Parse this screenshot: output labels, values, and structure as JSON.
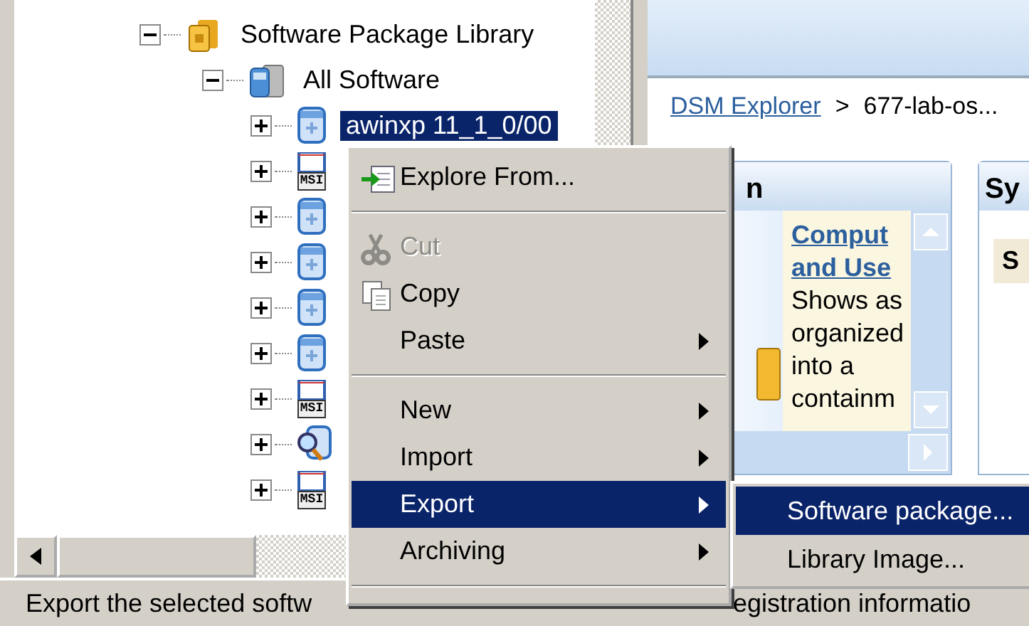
{
  "tree": {
    "items": [
      {
        "label": "Software Package Library",
        "kind": "library",
        "expanded": true,
        "selected": false,
        "children": [
          {
            "label": "All Software",
            "kind": "folder",
            "expanded": true,
            "selected": false,
            "children": [
              {
                "label": "awinxp 11_1_0/00",
                "kind": "package",
                "expanded": false,
                "selected": true
              },
              {
                "kind": "msi",
                "badge": "MSI",
                "expanded": false
              },
              {
                "kind": "package",
                "expanded": false
              },
              {
                "kind": "package",
                "expanded": false
              },
              {
                "kind": "package",
                "expanded": false
              },
              {
                "kind": "package",
                "expanded": false
              },
              {
                "kind": "msi",
                "badge": "MSI",
                "expanded": false
              },
              {
                "kind": "search",
                "expanded": false
              },
              {
                "kind": "msi",
                "badge": "MSI",
                "expanded": false
              }
            ]
          }
        ]
      }
    ]
  },
  "breadcrumb": {
    "link": "DSM Explorer",
    "separator": ">",
    "current": "677-lab-os..."
  },
  "panels": [
    {
      "title": "n",
      "link_lines": [
        "Comput",
        "and Use"
      ],
      "text_lines": [
        "Shows as",
        "organized",
        "into a",
        "containm"
      ]
    },
    {
      "title": "Sy",
      "subtitle": "S"
    }
  ],
  "status_bar": [
    "Export the selected softw",
    "egistration informatio"
  ],
  "context_menu": {
    "items": [
      {
        "kind": "item",
        "label": "Explore From...",
        "disabled": false,
        "selected": false,
        "submenu": false
      },
      {
        "kind": "separator"
      },
      {
        "kind": "item",
        "label": "Cut",
        "disabled": true,
        "selected": false,
        "submenu": false
      },
      {
        "kind": "item",
        "label": "Copy",
        "disabled": false,
        "selected": false,
        "submenu": false
      },
      {
        "kind": "item",
        "label": "Paste",
        "disabled": false,
        "selected": false,
        "submenu": true
      },
      {
        "kind": "separator"
      },
      {
        "kind": "item",
        "label": "New",
        "disabled": false,
        "selected": false,
        "submenu": true
      },
      {
        "kind": "item",
        "label": "Import",
        "disabled": false,
        "selected": false,
        "submenu": true
      },
      {
        "kind": "item",
        "label": "Export",
        "disabled": false,
        "selected": true,
        "submenu": true
      },
      {
        "kind": "item",
        "label": "Archiving",
        "disabled": false,
        "selected": false,
        "submenu": true
      },
      {
        "kind": "separator"
      }
    ]
  },
  "submenu": {
    "items": [
      {
        "label": "Software package...",
        "selected": true
      },
      {
        "label": "Library Image...",
        "selected": false
      }
    ]
  }
}
